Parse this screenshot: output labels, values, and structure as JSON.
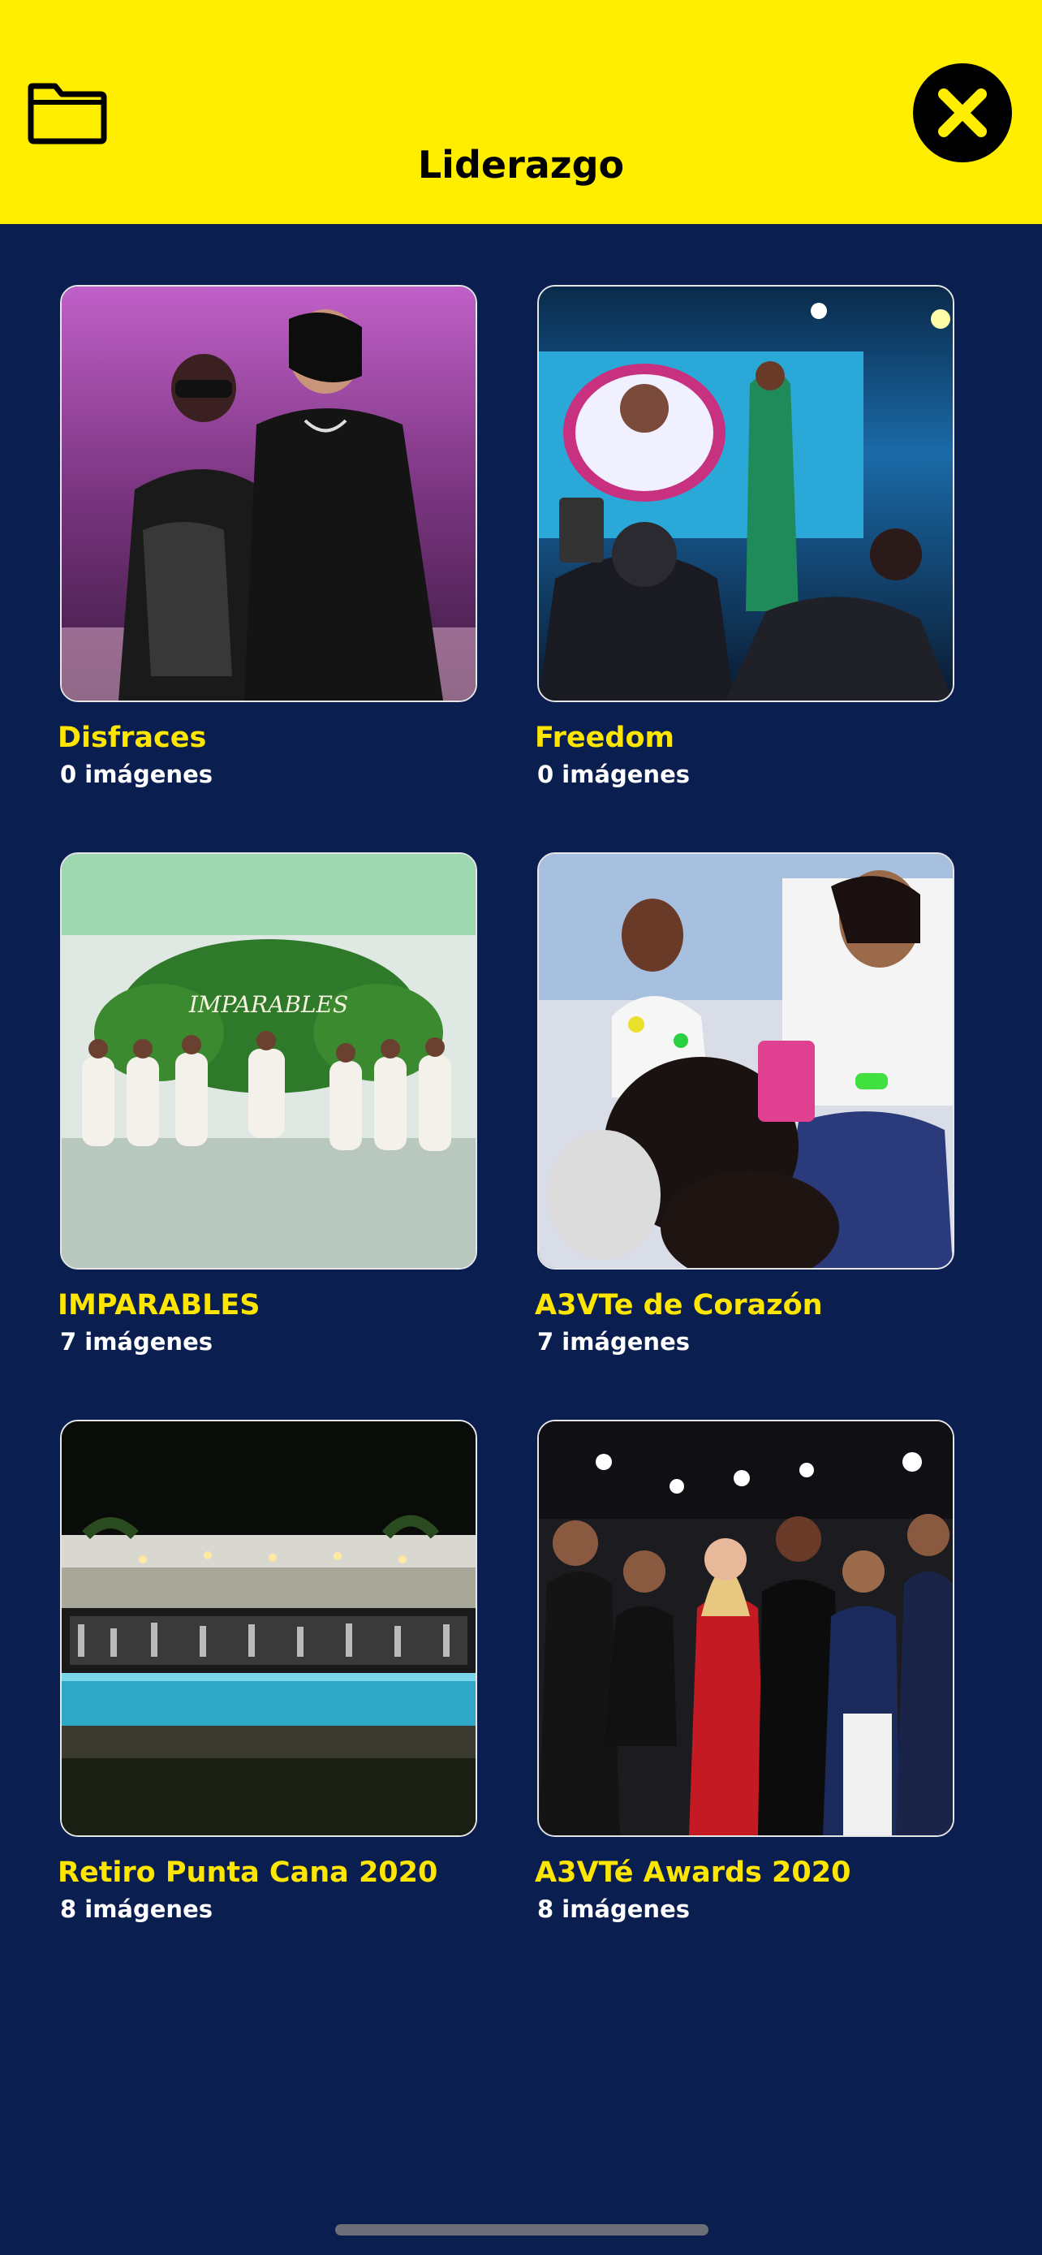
{
  "header": {
    "title": "Liderazgo",
    "folder_icon": "folder-icon",
    "close_icon": "close-icon"
  },
  "albums": [
    {
      "name": "Disfraces",
      "count": "0 imágenes"
    },
    {
      "name": "Freedom",
      "count": "0 imágenes"
    },
    {
      "name": "IMPARABLES",
      "count": "7 imágenes",
      "thumb_text": "IMPARABLES"
    },
    {
      "name": "A3VTe de Corazón",
      "count": "7 imágenes"
    },
    {
      "name": "Retiro Punta Cana 2020",
      "count": "8 imágenes"
    },
    {
      "name": "A3VTé Awards 2020",
      "count": "8 imágenes"
    }
  ],
  "colors": {
    "header_bg": "#ffee00",
    "page_bg": "#0a1e4f",
    "album_title": "#ffe600",
    "album_count": "#ffffff"
  }
}
